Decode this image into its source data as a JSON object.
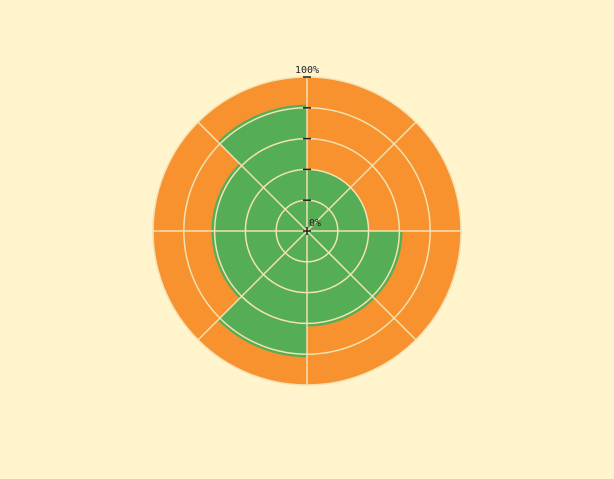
{
  "chart_data": {
    "type": "radar-area",
    "categories": [
      "",
      "",
      "",
      "",
      "",
      "",
      "",
      ""
    ],
    "series": [
      {
        "values": [
          100,
          100,
          100,
          100,
          100,
          100,
          100,
          100
        ],
        "color": "#f7922e"
      },
      {
        "values": [
          40,
          40,
          62,
          62,
          82,
          62,
          62,
          82
        ],
        "color": "#55ad55"
      }
    ],
    "rlim": [
      0,
      100
    ],
    "r_ticks": [
      0,
      20,
      40,
      60,
      80,
      100
    ],
    "r_labels": [
      {
        "value": 0,
        "text": "0%"
      },
      {
        "value": 100,
        "text": "100%"
      }
    ],
    "grid": true,
    "colors": {
      "background": "#fff4cc",
      "grid": "#f3e2b3",
      "axis_tick": "#222222"
    }
  }
}
